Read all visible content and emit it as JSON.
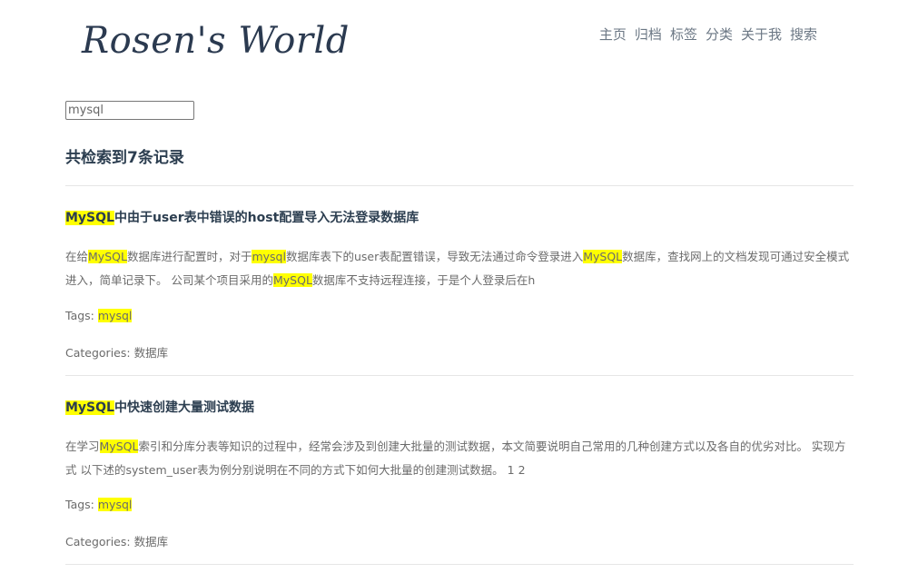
{
  "header": {
    "logo": "Rosen's World",
    "nav": [
      {
        "label": "主页"
      },
      {
        "label": "归档"
      },
      {
        "label": "标签"
      },
      {
        "label": "分类"
      },
      {
        "label": "关于我"
      },
      {
        "label": "搜索"
      }
    ]
  },
  "search": {
    "value": "mysql"
  },
  "results": {
    "count_text": "共检索到7条记录",
    "highlight_color": "#ffff00",
    "items": [
      {
        "title_highlight": "MySQL",
        "title_rest": "中由于user表中错误的host配置导入无法登录数据库",
        "excerpt_segments": [
          {
            "text": "在给",
            "hl": false
          },
          {
            "text": "MySQL",
            "hl": true
          },
          {
            "text": "数据库进行配置时，对于",
            "hl": false
          },
          {
            "text": "mysql",
            "hl": true
          },
          {
            "text": "数据库表下的user表配置错误，导致无法通过命令登录进入",
            "hl": false
          },
          {
            "text": "MySQL",
            "hl": true
          },
          {
            "text": "数据库，查找网上的文档发现可通过安全模式进入，简单记录下。 公司某个项目采用的",
            "hl": false
          },
          {
            "text": "MySQL",
            "hl": true
          },
          {
            "text": "数据库不支持远程连接，于是个人登录后在h",
            "hl": false
          }
        ],
        "tags_label": "Tags:",
        "tag": "mysql",
        "categories_label": "Categories:",
        "category": "数据库"
      },
      {
        "title_highlight": "MySQL",
        "title_rest": "中快速创建大量测试数据",
        "excerpt_segments": [
          {
            "text": "在学习",
            "hl": false
          },
          {
            "text": "MySQL",
            "hl": true
          },
          {
            "text": "索引和分库分表等知识的过程中，经常会涉及到创建大批量的测试数据，本文简要说明自己常用的几种创建方式以及各自的优劣对比。 实现方式 以下述的system_user表为例分别说明在不同的方式下如何大批量的创建测试数据。 1 2",
            "hl": false
          }
        ],
        "tags_label": "Tags:",
        "tag": "mysql",
        "categories_label": "Categories:",
        "category": "数据库"
      }
    ]
  }
}
